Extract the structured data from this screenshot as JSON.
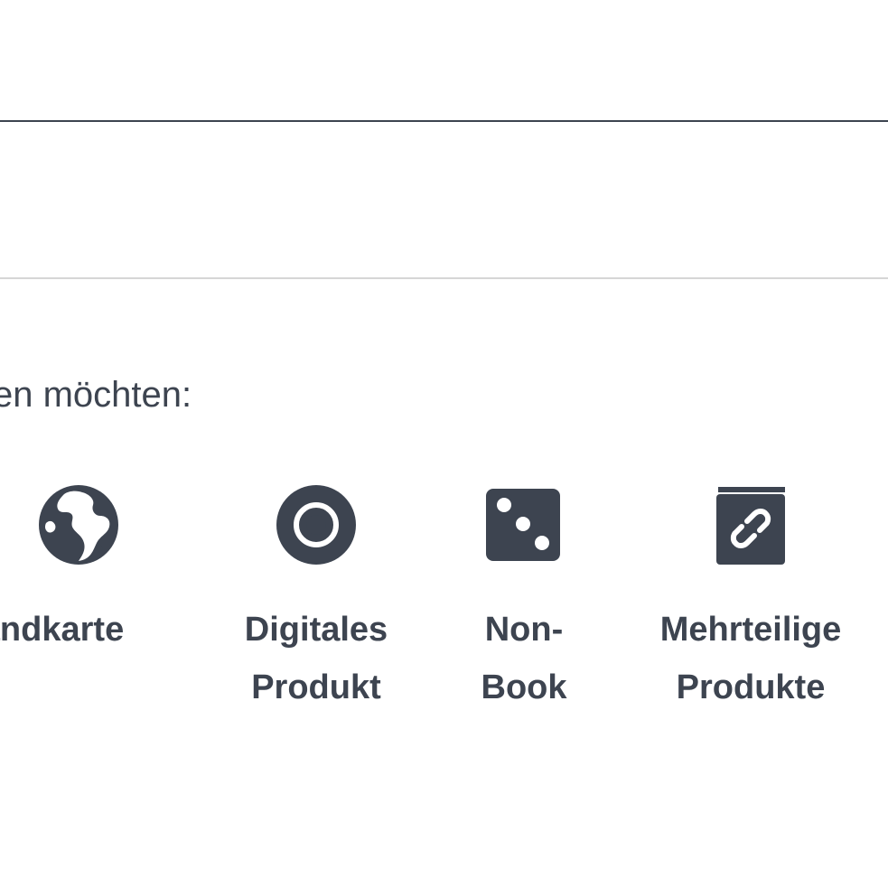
{
  "prompt": {
    "text": "en möchten:"
  },
  "product_types": [
    {
      "icon": "globe-icon",
      "label_line1": "andkarte",
      "label_line2": ""
    },
    {
      "icon": "disc-icon",
      "label_line1": "Digitales",
      "label_line2": "Produkt"
    },
    {
      "icon": "dice-icon",
      "label_line1": "Non-",
      "label_line2": "Book"
    },
    {
      "icon": "linked-book-icon",
      "label_line1": "Mehrteilige",
      "label_line2": "Produkte"
    }
  ],
  "colors": {
    "text": "#3d4450",
    "divider_dark": "#3d4450",
    "divider_light": "#d6d6d6",
    "background": "#ffffff"
  }
}
